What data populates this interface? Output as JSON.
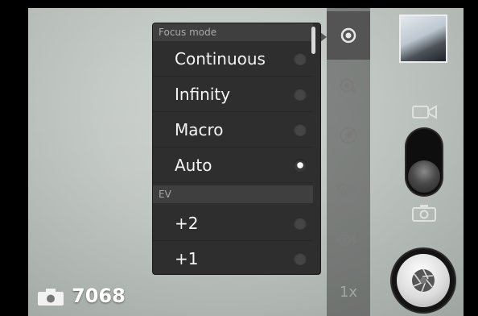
{
  "popup": {
    "sections": [
      {
        "title": "Focus mode",
        "options": [
          {
            "label": "Continuous",
            "selected": false
          },
          {
            "label": "Infinity",
            "selected": false
          },
          {
            "label": "Macro",
            "selected": false
          },
          {
            "label": "Auto",
            "selected": true
          }
        ]
      },
      {
        "title": "EV",
        "options": [
          {
            "label": "+2",
            "selected": false
          },
          {
            "label": "+1",
            "selected": false
          }
        ]
      }
    ]
  },
  "side_strip": {
    "items": [
      {
        "icon": "focus-mode-icon",
        "active": true
      },
      {
        "icon": "exposure-icon",
        "active": false
      },
      {
        "icon": "scene-mode-icon",
        "active": false
      },
      {
        "icon": "white-balance-icon",
        "active": false
      },
      {
        "icon": "flash-auto-icon",
        "active": false
      }
    ],
    "zoom_label": "1x"
  },
  "counter": {
    "remaining": "7068"
  },
  "controls": {
    "mode": "camera"
  }
}
